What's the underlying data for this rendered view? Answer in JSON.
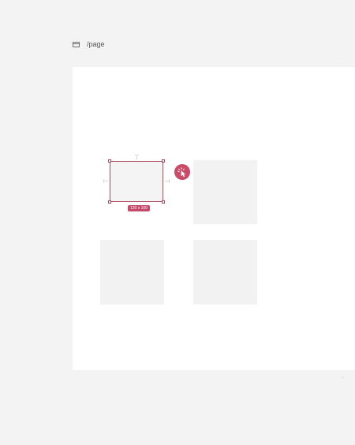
{
  "header": {
    "page_path": "/page"
  },
  "selection": {
    "size_label": "120 x 100"
  },
  "icons": {
    "page": "page-icon",
    "cursor": "click-cursor-icon"
  },
  "colors": {
    "background": "#f3f3f3",
    "canvas": "#ffffff",
    "frame_fill": "#f2f2f2",
    "accent": "#c4496b"
  }
}
